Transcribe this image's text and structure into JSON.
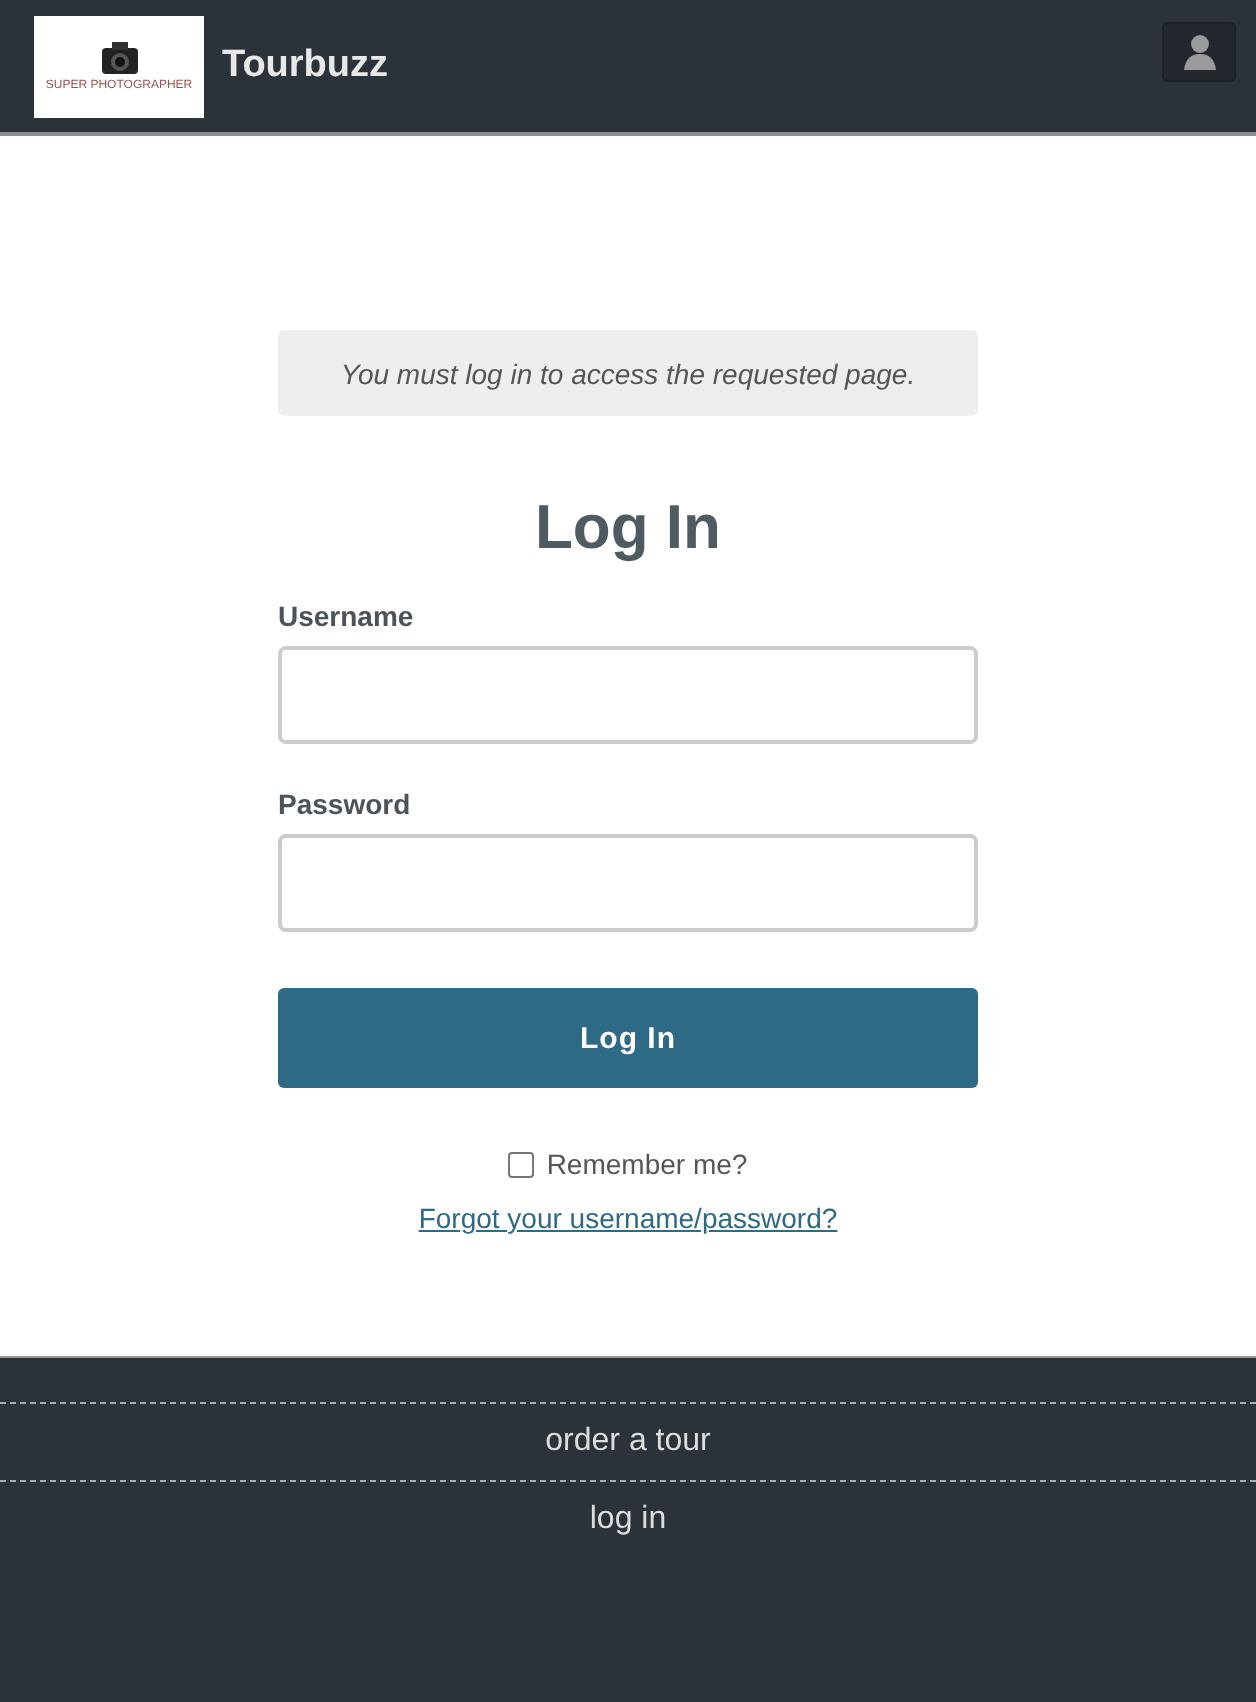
{
  "header": {
    "logo_caption": "SUPER PHOTOGRAPHER",
    "site_name": "Tourbuzz"
  },
  "notice": "You must log in to access the requested page.",
  "title": "Log In",
  "fields": [
    {
      "label": "Username"
    },
    {
      "label": "Password"
    }
  ],
  "submit": "Log In",
  "remember": {
    "label": "Remember me?",
    "checked": false
  },
  "forgot_link": "Forgot your username/password?",
  "footer_links": [
    "order a tour",
    "log in"
  ]
}
